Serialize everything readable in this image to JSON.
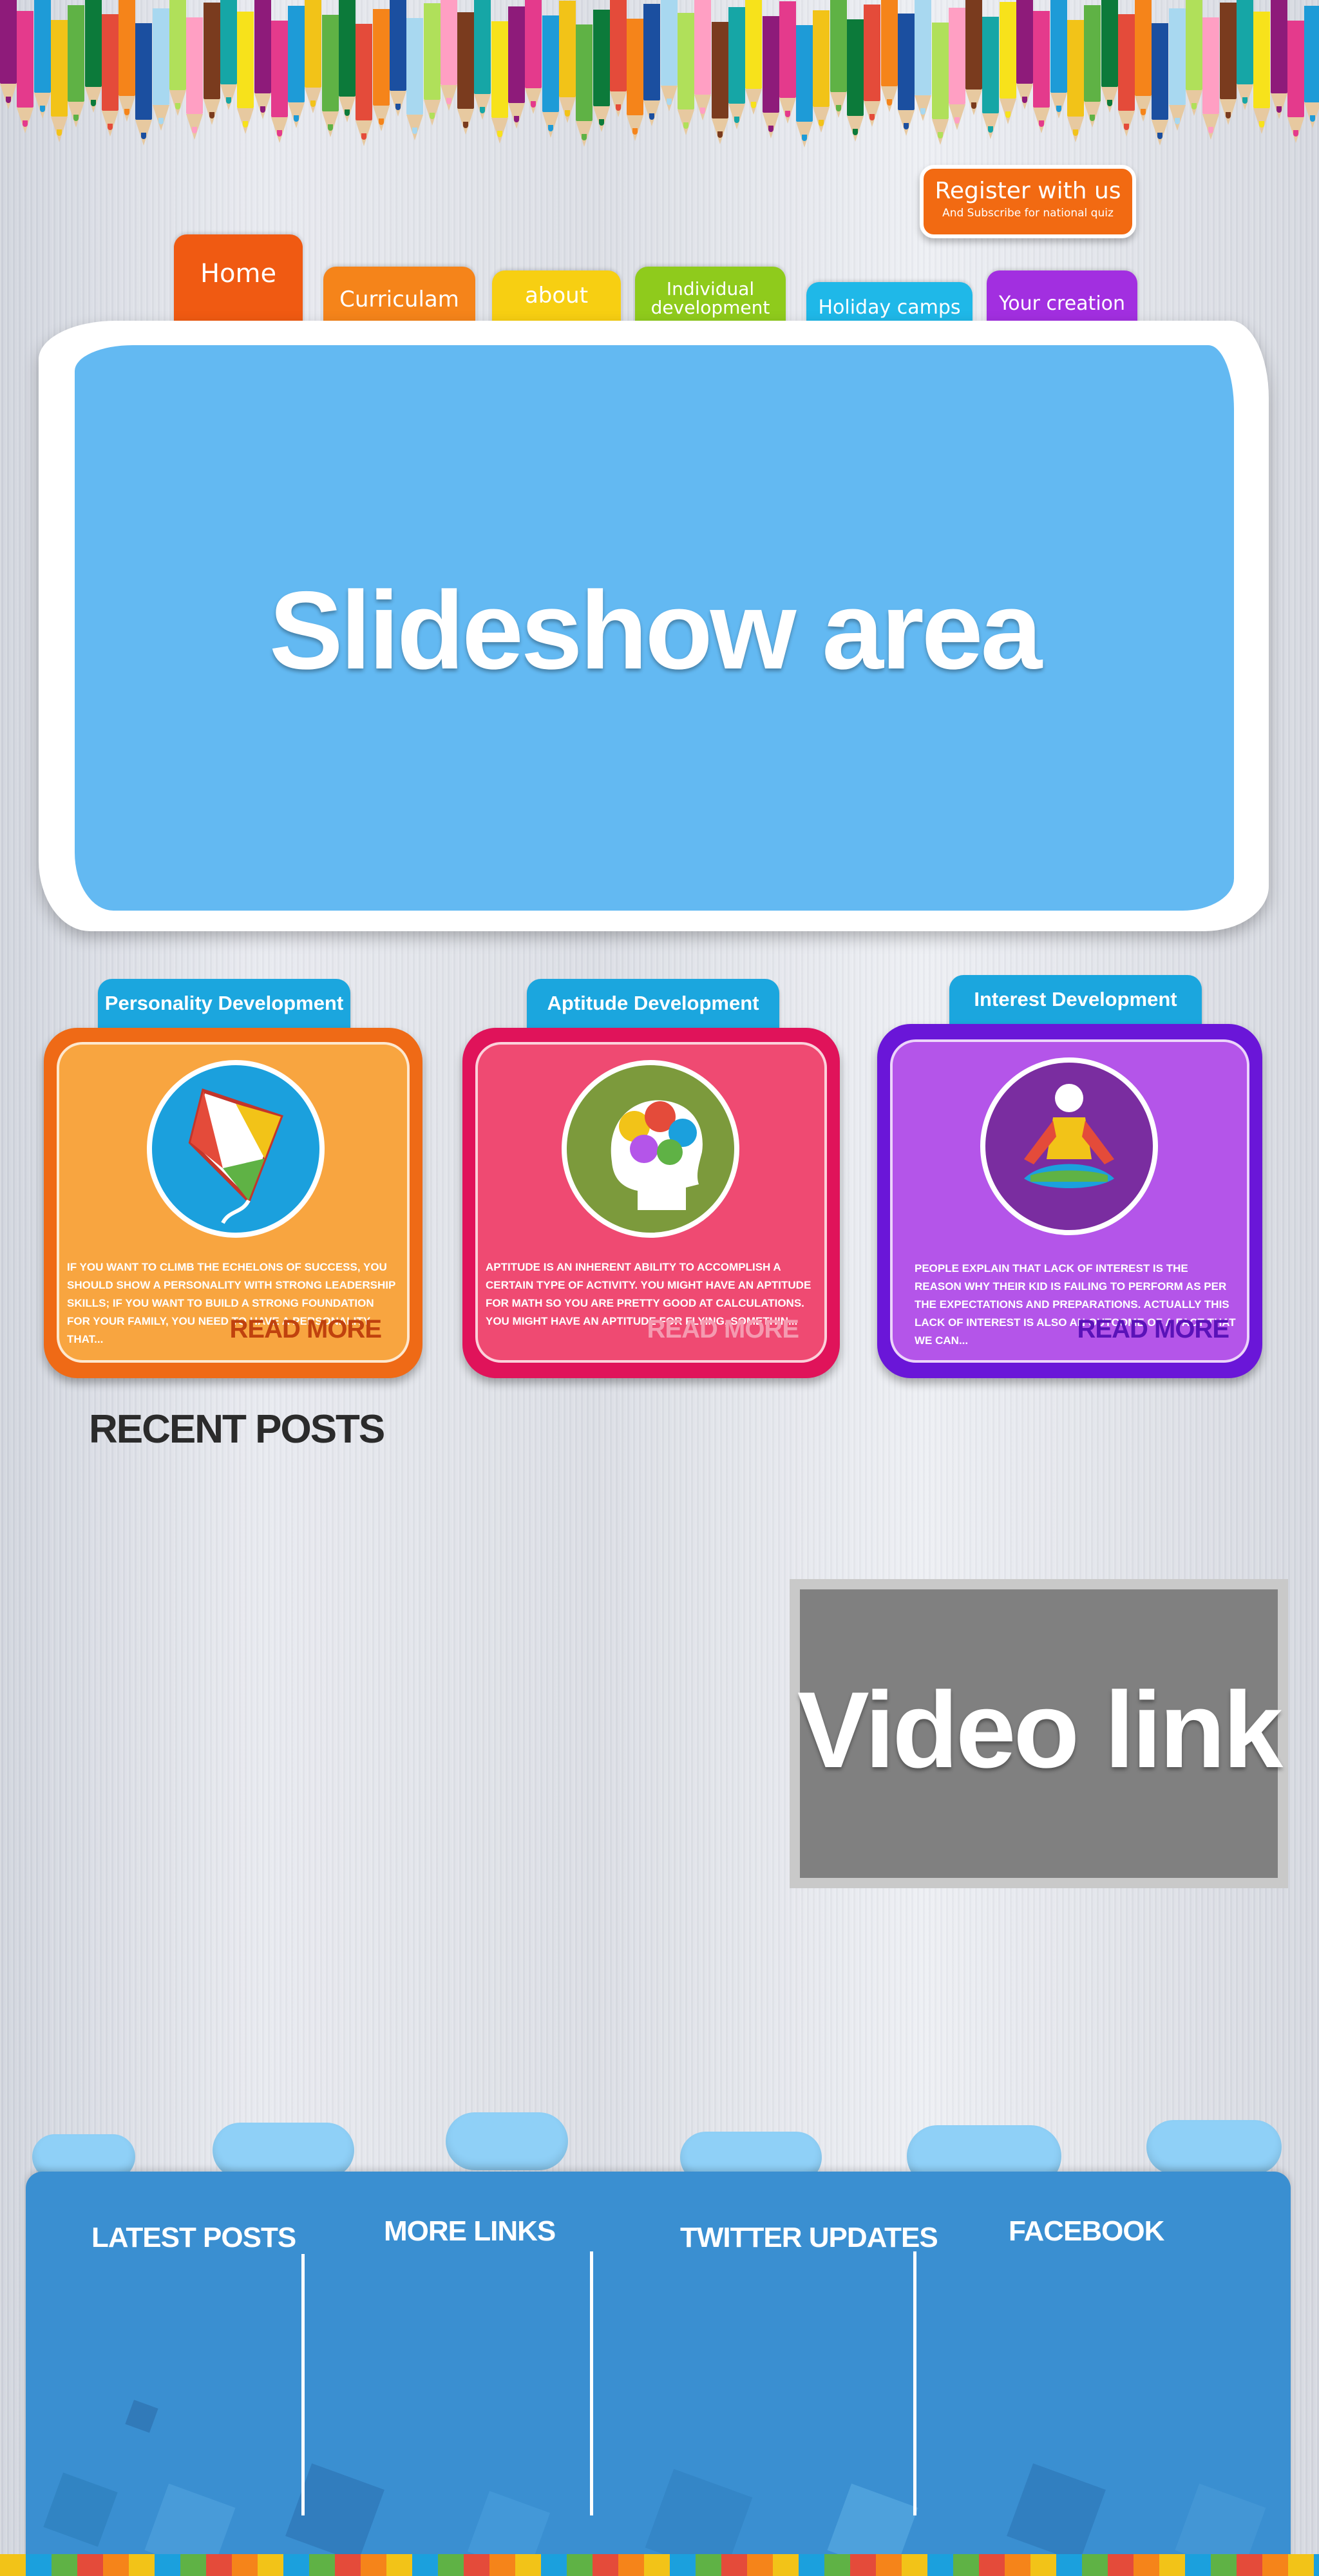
{
  "register": {
    "title": "Register with us",
    "subtitle": "And Subscribe for national quiz"
  },
  "nav": {
    "tabs": [
      {
        "label": "Home"
      },
      {
        "label": "Curriculam"
      },
      {
        "label": "about"
      },
      {
        "label": "Individual development"
      },
      {
        "label": "Holiday camps"
      },
      {
        "label": "Your creation"
      }
    ]
  },
  "slideshow": {
    "label": "Slideshow area"
  },
  "cards": [
    {
      "title": "Personality Development",
      "text": "If you want to climb the echelons of success, you should show a personality with strong leadership skills; if you want to build a strong foundation for your family, you need to have a personality that...",
      "read_more": "Read More",
      "icon": "kite-icon",
      "color": "#f8a540"
    },
    {
      "title": "Aptitude Development",
      "text": "Aptitude is an inherent ability to accomplish a certain type of activity. You might have an aptitude for math so you are pretty good at calculations. You might have an aptitude for flying, somethin...",
      "read_more": "Read More",
      "icon": "brain-head-icon",
      "color": "#ef4a72"
    },
    {
      "title": "Interest Development",
      "text": "People explain that lack of interest is the reason why their kid is failing to perform as per the expectations and preparations. Actually this lack of interest is also an outcome of a fact that we can...",
      "read_more": "Read More",
      "icon": "meditation-icon",
      "color": "#b455e9"
    }
  ],
  "recent_posts": {
    "title": "RECENT POSTS"
  },
  "video": {
    "label": "Video link"
  },
  "footer": {
    "columns": [
      {
        "title": "LATEST POSTS"
      },
      {
        "title": "MORE LINKS"
      },
      {
        "title": "TWITTER UPDATES"
      },
      {
        "title": "FACEBOOK"
      }
    ]
  },
  "colors": {
    "footer_blue": "#3a8fd1",
    "slideshow_blue": "#63b9f2",
    "register_orange": "#f26a12"
  }
}
